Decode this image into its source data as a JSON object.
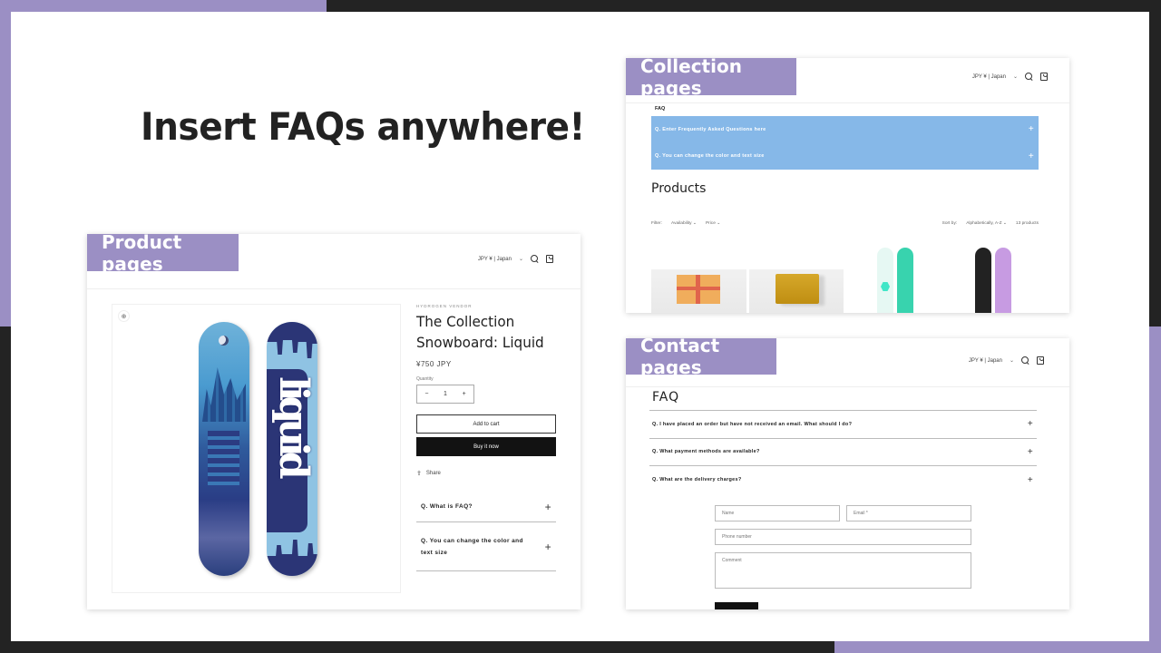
{
  "headline": "Insert FAQs anywhere!",
  "colors": {
    "accent_purple": "#9b8fc4",
    "dark": "#232323",
    "faq_blue": "#86b8e8"
  },
  "store_header": {
    "locale": "JPY ¥ | Japan",
    "locale_icon": "chevron-down-icon",
    "search_icon": "search-icon",
    "cart_icon": "cart-icon"
  },
  "product_card": {
    "tag": "Product pages",
    "zoom_icon": "magnify-icon",
    "vendor": "HYDROGEN VENDOR",
    "title": "The Collection Snowboard: Liquid",
    "price": "¥750 JPY",
    "quantity_label": "Quantity",
    "quantity_value": "1",
    "qty_minus": "−",
    "qty_plus": "+",
    "add_to_cart": "Add to cart",
    "buy_now": "Buy it now",
    "share": "Share",
    "board_word": "liquid",
    "faq": [
      {
        "question": "Q. What is FAQ?"
      },
      {
        "question": "Q. You can change the color and text size"
      }
    ]
  },
  "collection_card": {
    "tag": "Collection pages",
    "faq_title": "FAQ",
    "faq": [
      {
        "question": "Q. Enter Frequently Asked Questions here"
      },
      {
        "question": "Q. You can change the color and text size"
      }
    ],
    "heading": "Products",
    "filter_label": "Filter:",
    "filter_availability": "Availability ⌄",
    "filter_price": "Price ⌄",
    "sort_label": "Sort by:",
    "sort_value": "Alphabetically, A-Z ⌄",
    "count": "13 products",
    "products": [
      "gift-card",
      "snowboard-wax",
      "mint-snowboard",
      "black-lilac-snowboard"
    ]
  },
  "contact_card": {
    "tag": "Contact pages",
    "faq_title": "FAQ",
    "faq": [
      {
        "question": "Q. I have placed an order but have not received an email. What should I do?"
      },
      {
        "question": "Q. What payment methods are available?"
      },
      {
        "question": "Q. What are the delivery charges?"
      }
    ],
    "form": {
      "name_placeholder": "Name",
      "email_placeholder": "Email *",
      "phone_placeholder": "Phone number",
      "comment_placeholder": "Comment"
    }
  },
  "plus_glyph": "+"
}
